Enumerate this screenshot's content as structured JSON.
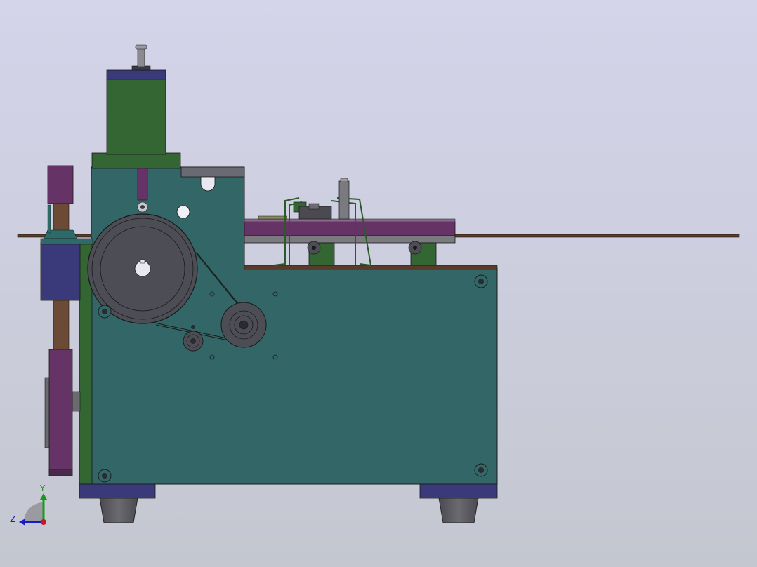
{
  "viewport": {
    "background_top": "#d4d4ea",
    "background_bottom": "#c4c7d0"
  },
  "model": {
    "colors": {
      "housing": "#336666",
      "housing_edge": "#1e3d3d",
      "motor_green": "#336633",
      "cap_navy": "#3a3a7a",
      "magenta": "#663366",
      "pulley_gray": "#4d4d55",
      "steel_gray": "#7a7a80",
      "rod_brown": "#5a3a2a",
      "column_brown": "#6b4a36",
      "foot_gray": "#5a5a60",
      "dark_outline": "#1a1a1a"
    }
  },
  "triad": {
    "y_label": "Y",
    "z_label": "Z",
    "y_color": "#1a9a1a",
    "z_color": "#1a1ac8",
    "origin_color": "#c81a1a"
  }
}
